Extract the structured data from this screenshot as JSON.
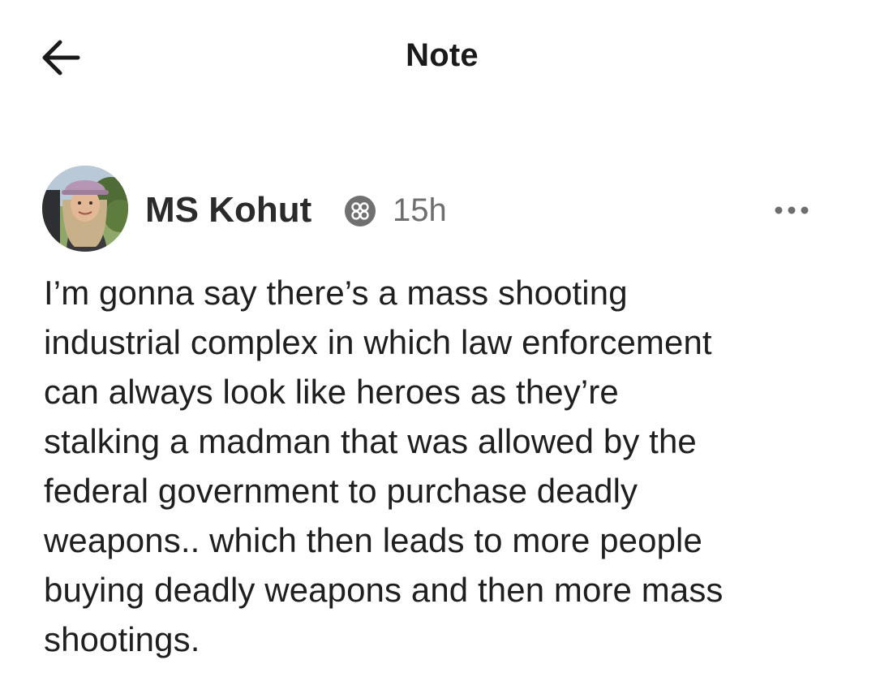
{
  "header": {
    "title": "Note",
    "back_icon": "arrow-left-icon"
  },
  "post": {
    "author": "MS Kohut",
    "badge_icon": "subscriber-badge-icon",
    "timestamp": "15h",
    "more_icon": "more-horizontal-icon",
    "avatar_icon": "user-avatar",
    "body_lines": [
      "I’m gonna say there’s a mass shooting",
      "industrial complex in which law enforcement",
      "can always look like heroes as they’re",
      "stalking a madman that was allowed by the",
      "federal government to purchase deadly",
      "weapons.. which then leads to more people",
      "buying deadly weapons and then more mass",
      "shootings."
    ]
  },
  "colors": {
    "text": "#1f1f1f",
    "muted": "#6e6e6e",
    "badge": "#6e6e6e"
  }
}
